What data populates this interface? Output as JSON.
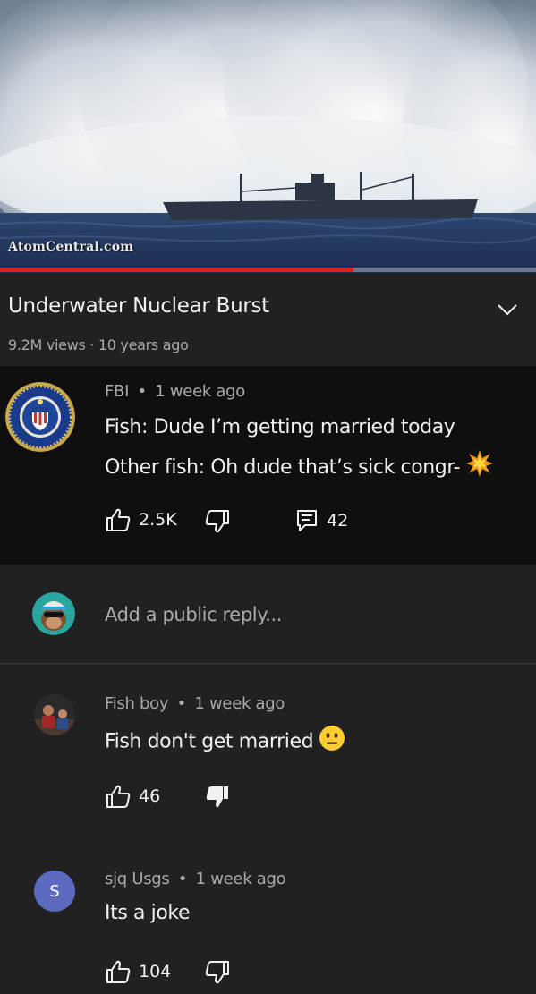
{
  "video": {
    "watermark": "AtomCentral.com",
    "progress_fraction": 0.66,
    "progress_color": "#e0201b"
  },
  "info": {
    "title": "Underwater Nuclear Burst",
    "meta": "9.2M views · 10 years ago",
    "expand_icon": "chevron-down-icon"
  },
  "comment": {
    "author": "FBI",
    "time": "1 week ago",
    "line1": "Fish: Dude I’m getting married today",
    "line2": "Other fish: Oh dude that’s sick congr-",
    "line2_emoji": "collision",
    "likes": "2.5K",
    "replies": "42",
    "avatar_icon": "fbi-seal-icon"
  },
  "reply_box": {
    "placeholder": "Add a public reply..."
  },
  "replies": [
    {
      "author": "Fish boy",
      "time": "1 week ago",
      "text": "Fish don't get married",
      "emoji": "neutral-face",
      "likes": "46",
      "disliked": true
    },
    {
      "author": "sjq Usgs",
      "time": "1 week ago",
      "text": "Its a joke",
      "avatar_letter": "S",
      "avatar_color": "#5c6bc0",
      "likes": "104",
      "disliked": false
    }
  ],
  "separator": "•"
}
